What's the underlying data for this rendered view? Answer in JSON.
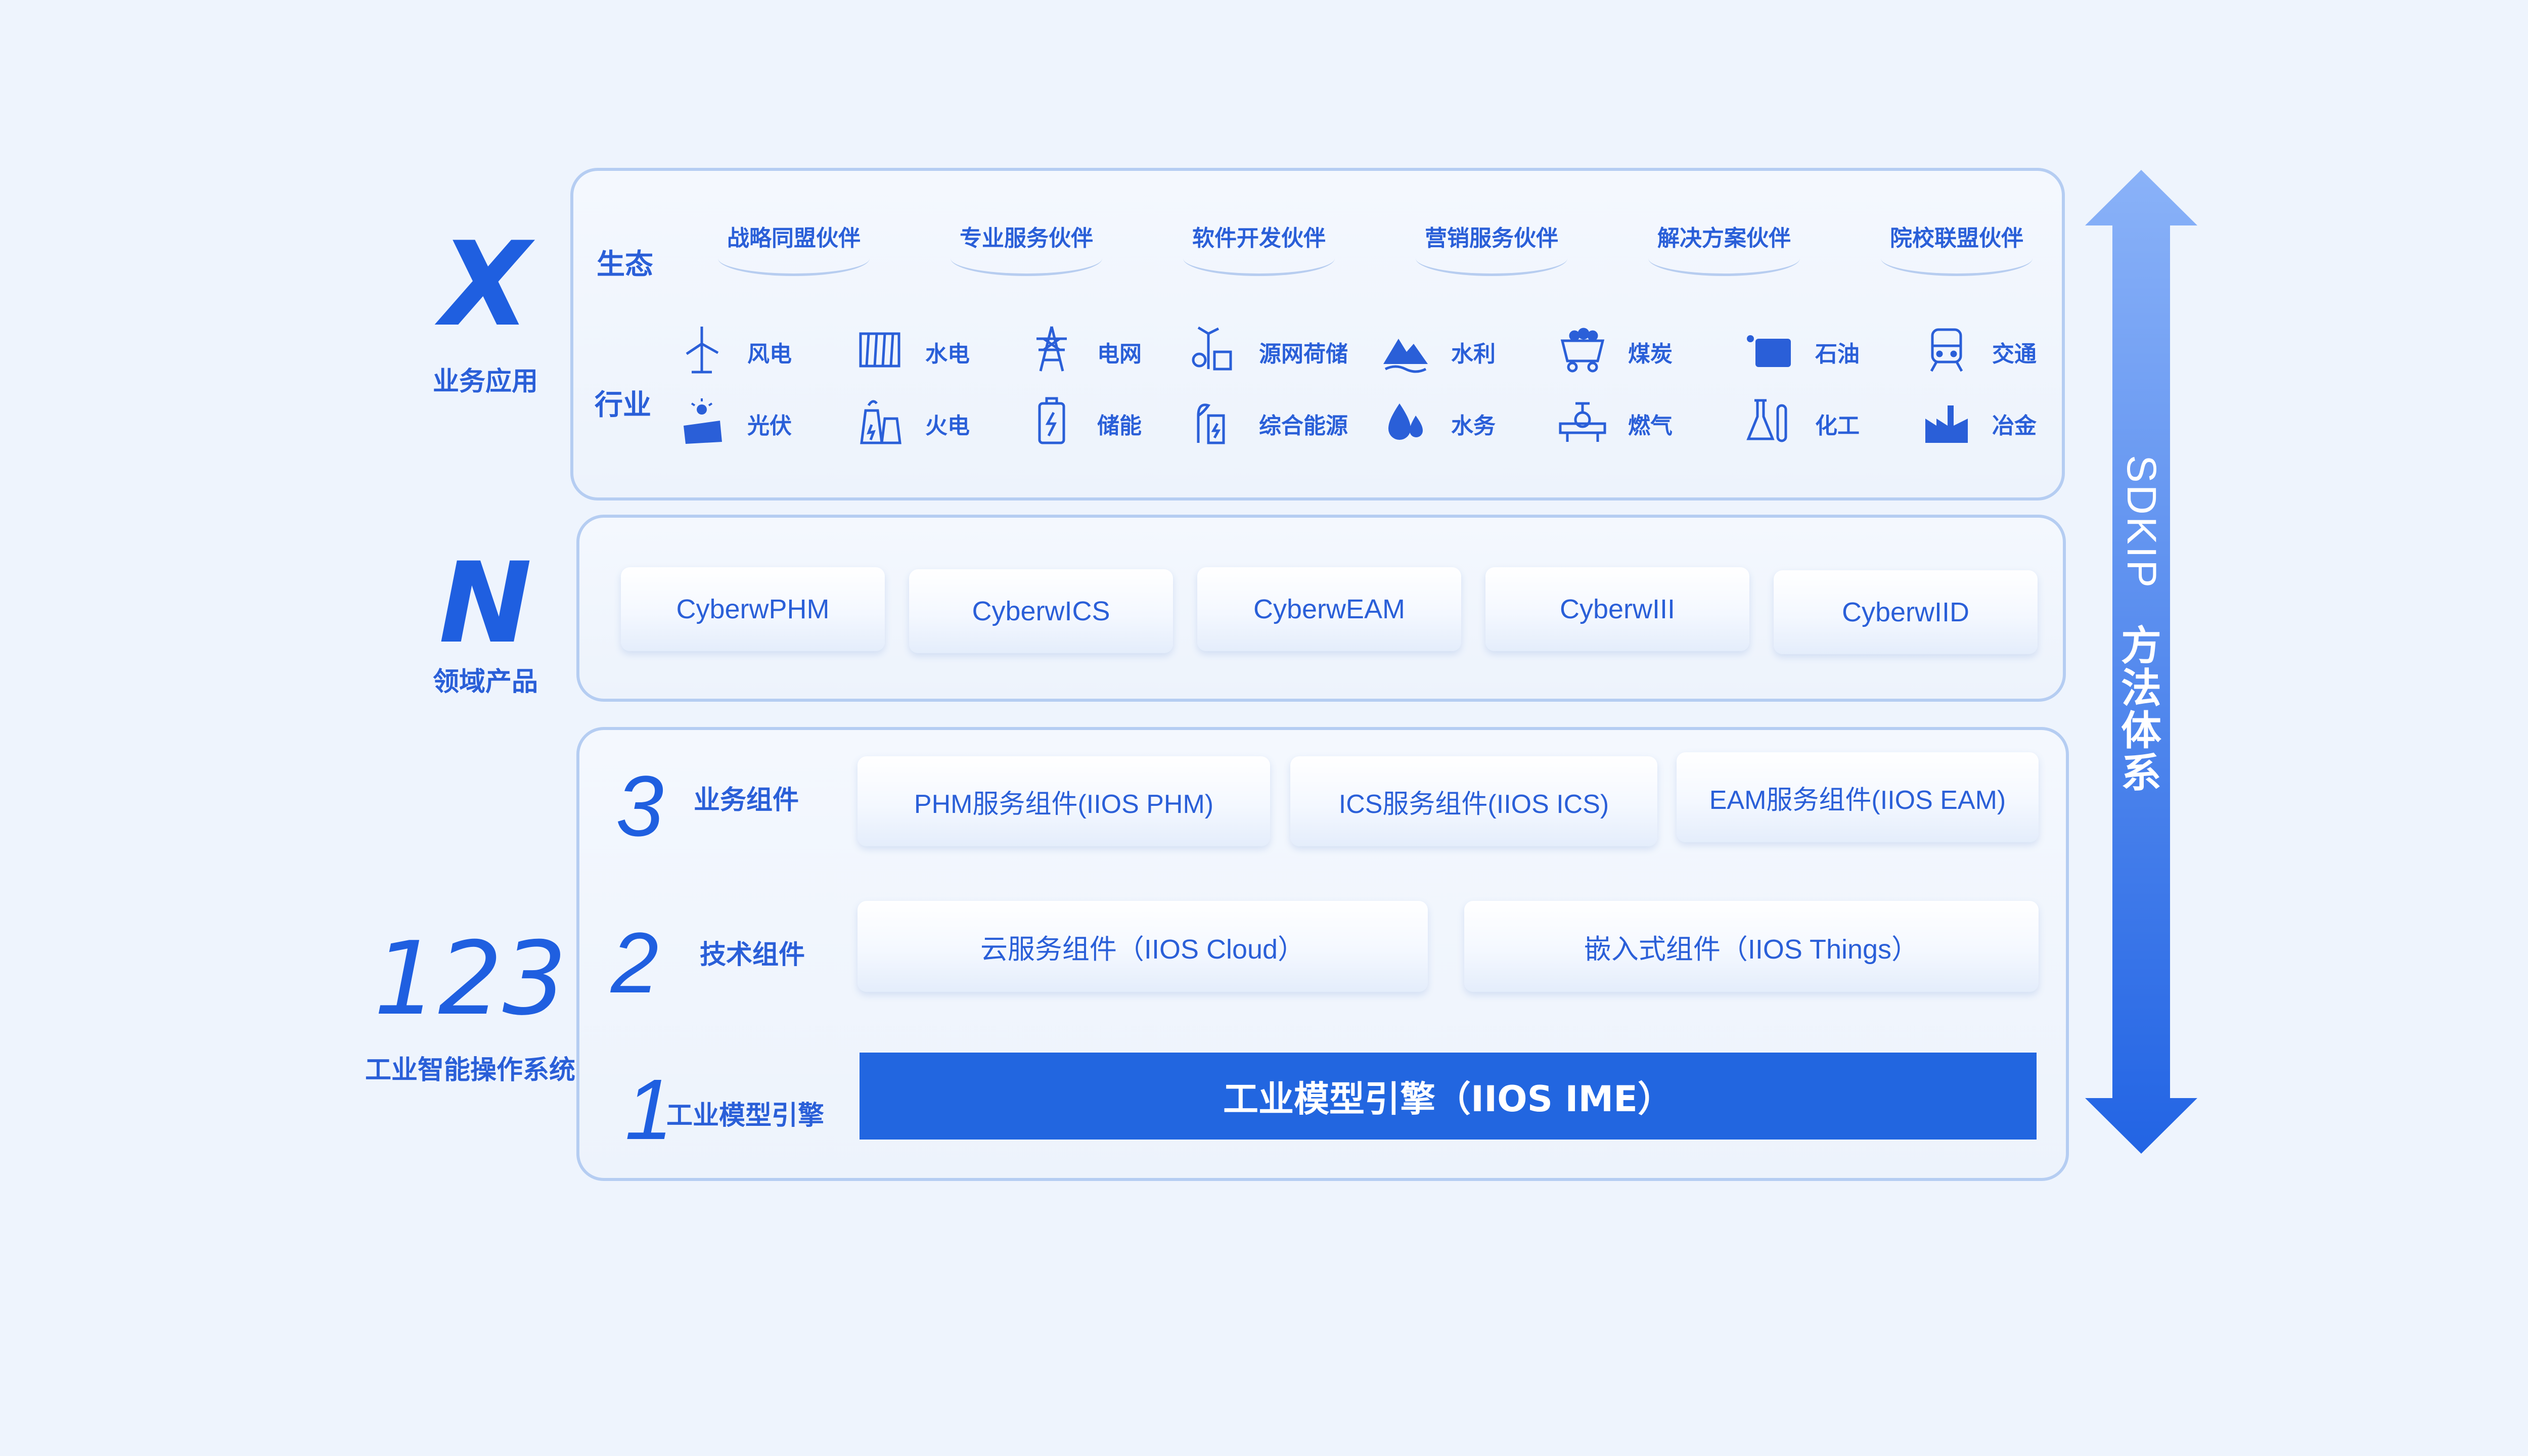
{
  "left": {
    "x_letter": "X",
    "x_label": "业务应用",
    "n_letter": "N",
    "n_label": "领域产品",
    "num_letters": "123",
    "num_label": "工业智能操作系统"
  },
  "ecosystem": {
    "title": "生态",
    "partners": [
      "战略同盟伙伴",
      "专业服务伙伴",
      "软件开发伙伴",
      "营销服务伙伴",
      "解决方案伙伴",
      "院校联盟伙伴"
    ]
  },
  "industry": {
    "title": "行业",
    "row1": [
      {
        "label": "风电",
        "icon": "wind-turbine-icon"
      },
      {
        "label": "水电",
        "icon": "hydro-dam-icon"
      },
      {
        "label": "电网",
        "icon": "power-tower-icon"
      },
      {
        "label": "源网荷储",
        "icon": "source-grid-storage-icon"
      },
      {
        "label": "水利",
        "icon": "water-conservancy-icon"
      },
      {
        "label": "煤炭",
        "icon": "coal-cart-icon"
      },
      {
        "label": "石油",
        "icon": "oil-tank-icon"
      },
      {
        "label": "交通",
        "icon": "train-icon"
      }
    ],
    "row2": [
      {
        "label": "光伏",
        "icon": "solar-panel-icon"
      },
      {
        "label": "火电",
        "icon": "thermal-plant-icon"
      },
      {
        "label": "储能",
        "icon": "battery-icon"
      },
      {
        "label": "综合能源",
        "icon": "integrated-energy-icon"
      },
      {
        "label": "水务",
        "icon": "water-drop-icon"
      },
      {
        "label": "燃气",
        "icon": "gas-valve-icon"
      },
      {
        "label": "化工",
        "icon": "flask-icon"
      },
      {
        "label": "冶金",
        "icon": "factory-icon"
      }
    ]
  },
  "products": [
    "CyberwPHM",
    "CyberwICS",
    "CyberwEAM",
    "CyberwIII",
    "CyberwIID"
  ],
  "layers": {
    "business": {
      "num": "3",
      "label": "业务组件",
      "items": [
        "PHM服务组件(IIOS PHM)",
        "ICS服务组件(IIOS ICS)",
        "EAM服务组件(IIOS EAM)"
      ]
    },
    "tech": {
      "num": "2",
      "label": "技术组件",
      "items": [
        "云服务组件（IIOS Cloud）",
        "嵌入式组件（IIOS Things）"
      ]
    },
    "engine": {
      "num": "1",
      "label": "工业模型引擎",
      "text": "工业模型引擎（IIOS IME）"
    }
  },
  "side_arrow": {
    "latin": "SDKIP",
    "cn": [
      "方",
      "法",
      "体",
      "系"
    ],
    "color_top": "#8ab2f8",
    "color_bottom": "#2264e4"
  }
}
